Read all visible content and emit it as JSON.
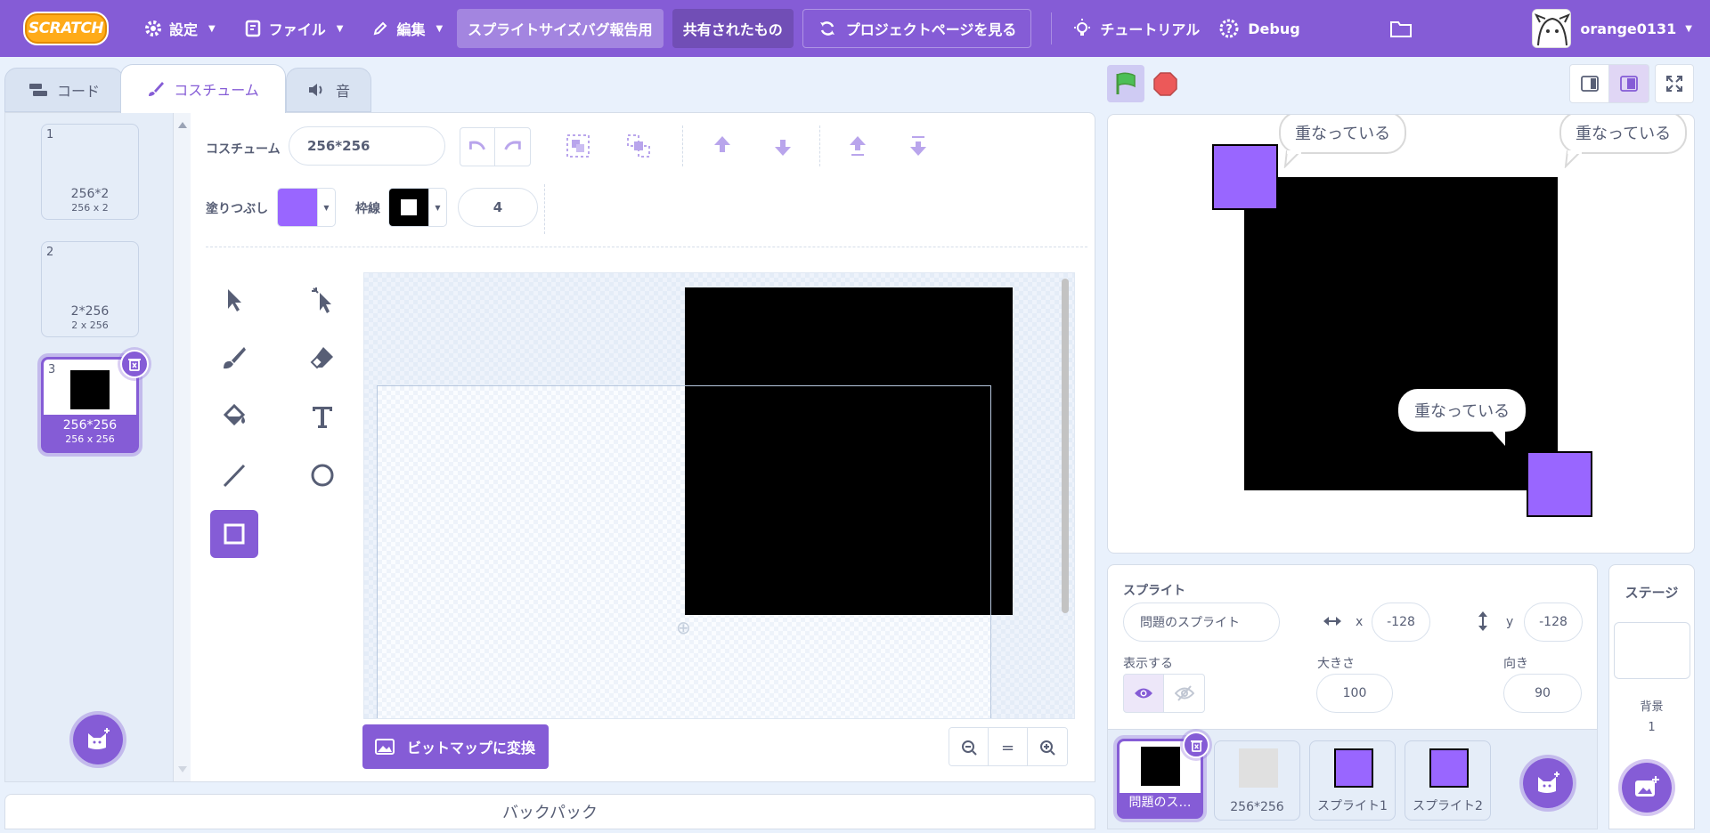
{
  "menubar": {
    "logo_text": "SCRATCH",
    "settings": "設定",
    "file": "ファイル",
    "edit": "編集",
    "project_title": "スプライトサイズバグ報告用",
    "shared": "共有されたもの",
    "see_project_page": "プロジェクトページを見る",
    "tutorials": "チュートリアル",
    "debug": "Debug",
    "username": "orange0131",
    "accent": "#855cd6"
  },
  "tabs": {
    "code": "コード",
    "costumes": "コスチューム",
    "sounds": "音"
  },
  "costumes": [
    {
      "num": "1",
      "name": "256*2",
      "size": "256 x 2"
    },
    {
      "num": "2",
      "name": "2*256",
      "size": "2 x 256"
    },
    {
      "num": "3",
      "name": "256*256",
      "size": "256 x 256"
    }
  ],
  "paint": {
    "costume_label": "コスチューム",
    "costume_name": "256*256",
    "fill_label": "塗りつぶし",
    "fill_color": "#9966ff",
    "outline_label": "枠線",
    "outline_color": "#000000",
    "outline_width": "4",
    "convert_bitmap": "ビットマップに変換",
    "zoom_reset": "="
  },
  "backpack": "バックパック",
  "stage": {
    "bubbles": [
      "重なっている",
      "重なっている",
      "重なっている"
    ]
  },
  "sprite_info": {
    "sprite_label": "スプライト",
    "sprite_name": "問題のスプライト",
    "x_label": "x",
    "x_value": "-128",
    "y_label": "y",
    "y_value": "-128",
    "show_label": "表示する",
    "size_label": "大きさ",
    "size_value": "100",
    "direction_label": "向き",
    "direction_value": "90"
  },
  "sprites": [
    {
      "name": "問題のス…",
      "selected": true
    },
    {
      "name": "256*256",
      "selected": false
    },
    {
      "name": "スプライト1",
      "selected": false
    },
    {
      "name": "スプライト2",
      "selected": false
    }
  ],
  "stage_panel": {
    "title": "ステージ",
    "backdrop_label": "背景",
    "backdrop_count": "1"
  }
}
